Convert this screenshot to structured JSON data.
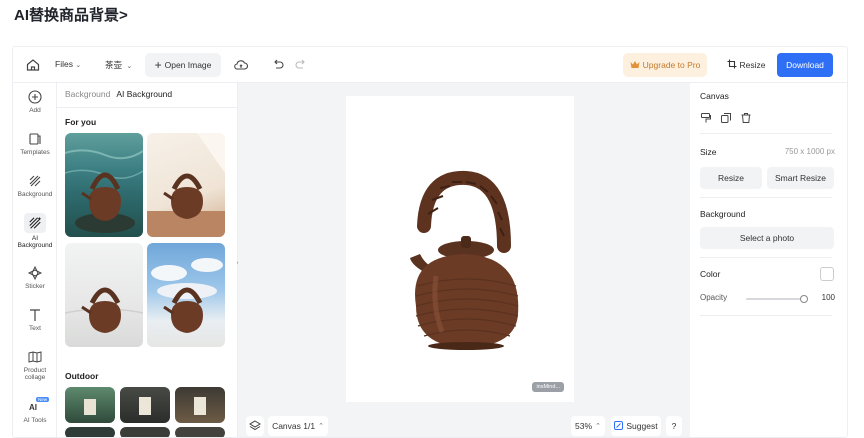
{
  "doc_title": "AI替换商品背景>",
  "topbar": {
    "files_label": "Files",
    "project_label": "茶壶",
    "open_image_label": "Open Image",
    "upgrade_label": "Upgrade to Pro",
    "resize_label": "Resize",
    "download_label": "Download"
  },
  "rail": [
    {
      "icon": "add-icon",
      "label": "Add"
    },
    {
      "icon": "templates-icon",
      "label": "Templates"
    },
    {
      "icon": "background-icon",
      "label": "Background"
    },
    {
      "icon": "ai-background-icon",
      "label": "AI Background",
      "active": true
    },
    {
      "icon": "sticker-icon",
      "label": "Sticker"
    },
    {
      "icon": "text-icon",
      "label": "Text"
    },
    {
      "icon": "product-collage-icon",
      "label": "Product collage"
    },
    {
      "icon": "ai-tools-icon",
      "label": "AI Tools",
      "badge": "New"
    }
  ],
  "panel": {
    "tab_background": "Background",
    "tab_ai_background": "AI Background",
    "section_for_you": "For you",
    "section_outdoor": "Outdoor"
  },
  "workspace": {
    "watermark": "insMind...",
    "canvas_label": "Canvas 1/1",
    "zoom": "53%",
    "suggest_label": "Suggest",
    "help": "?"
  },
  "props": {
    "canvas_title": "Canvas",
    "size_label": "Size",
    "size_value": "750 x 1000 px",
    "resize_btn": "Resize",
    "smart_resize_btn": "Smart Resize",
    "background_label": "Background",
    "select_photo_btn": "Select a photo",
    "color_label": "Color",
    "opacity_label": "Opacity",
    "opacity_value": "100"
  },
  "colors": {
    "accent": "#2f6ff5",
    "upgrade_bg": "#fdf0de",
    "upgrade_text": "#c4792a",
    "teapot": "#6b3b26"
  }
}
